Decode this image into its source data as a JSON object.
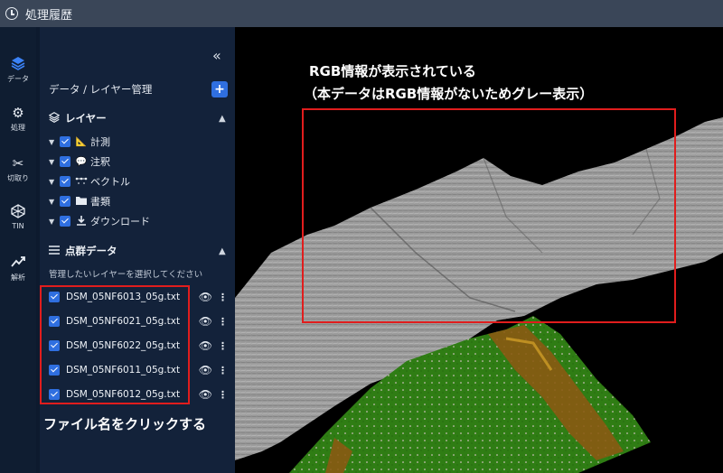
{
  "window": {
    "title": "処理履歴"
  },
  "rail": [
    {
      "label": "データ",
      "icon": "layers-icon"
    },
    {
      "label": "処理",
      "icon": "gears-icon"
    },
    {
      "label": "切取り",
      "icon": "scissors-icon"
    },
    {
      "label": "TIN",
      "icon": "tin-icon"
    },
    {
      "label": "解析",
      "icon": "chart-icon"
    }
  ],
  "panel": {
    "collapse_label": "«",
    "title": "データ / レイヤー管理",
    "add_label": "+",
    "layers_section": "レイヤー",
    "layers": [
      {
        "label": "計測",
        "icon": "measure-icon"
      },
      {
        "label": "注釈",
        "icon": "comment-icon"
      },
      {
        "label": "ベクトル",
        "icon": "vector-icon"
      },
      {
        "label": "書類",
        "icon": "folder-icon"
      },
      {
        "label": "ダウンロード",
        "icon": "download-icon"
      }
    ],
    "pointcloud_section": "点群データ",
    "hint": "管理したいレイヤーを選択してください",
    "files": [
      "DSM_05NF6013_05g.txt",
      "DSM_05NF6021_05g.txt",
      "DSM_05NF6022_05g.txt",
      "DSM_05NF6011_05g.txt",
      "DSM_05NF6012_05g.txt"
    ]
  },
  "annotations": {
    "rgb_line1": "RGB情報が表示されている",
    "rgb_line2": "（本データはRGB情報がないためグレー表示）",
    "click_hint": "ファイル名をクリックする"
  },
  "colors": {
    "accent": "#2f6fe0",
    "annotation_red": "#e11d1d",
    "terrain_gray": "#9a9a9a",
    "terrain_green": "#2e7d12",
    "terrain_brown": "#8a5a12"
  }
}
